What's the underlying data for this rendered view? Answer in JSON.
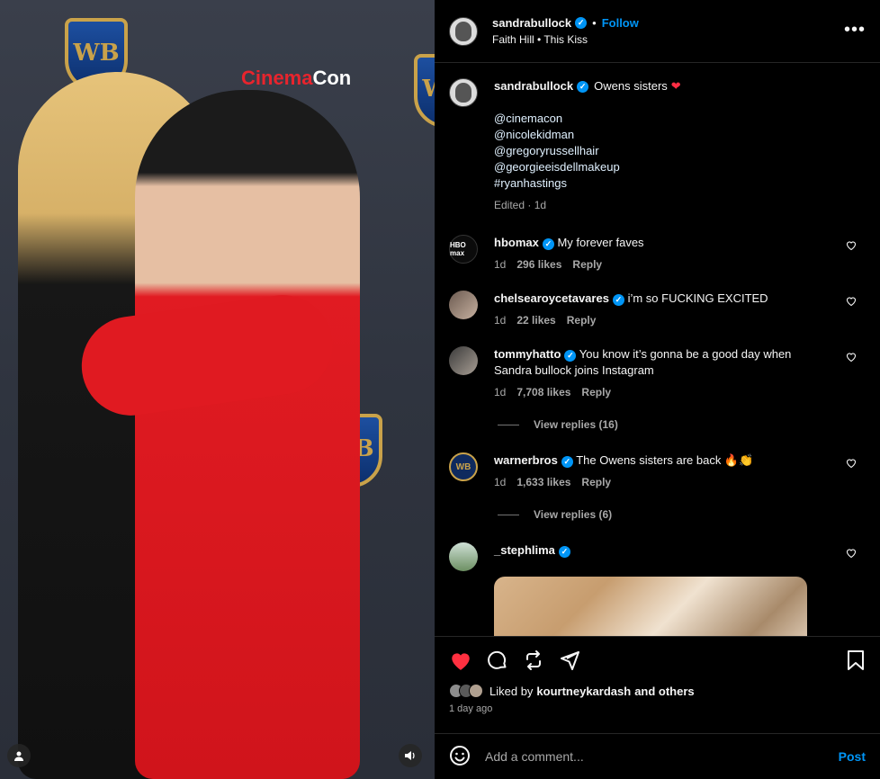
{
  "header": {
    "username": "sandrabullock",
    "follow_label": "Follow",
    "song": "Faith Hill • This Kiss",
    "more_label": "•••",
    "dot": "•"
  },
  "caption": {
    "username": "sandrabullock",
    "text": "Owens sisters",
    "emoji": "❤",
    "mentions": [
      "@cinemacon",
      "@nicolekidman",
      "@gregoryrussellhair",
      "@georgieeisdellmakeup",
      "#ryanhastings"
    ],
    "meta": "Edited · 1d"
  },
  "comments": [
    {
      "username": "hbomax",
      "text": "My forever faves",
      "time": "1d",
      "likes": "296 likes",
      "reply": "Reply",
      "avatar_label": "HBO max"
    },
    {
      "username": "chelsearoycetavares",
      "text": "i’m so FUCKING EXCITED",
      "time": "1d",
      "likes": "22 likes",
      "reply": "Reply"
    },
    {
      "username": "tommyhatto",
      "text": "You know it’s gonna be a good day when Sandra bullock joins Instagram",
      "time": "1d",
      "likes": "7,708 likes",
      "reply": "Reply",
      "view_replies": "View replies (16)"
    },
    {
      "username": "warnerbros",
      "text": "The Owens sisters are back 🔥👏",
      "time": "1d",
      "likes": "1,633 likes",
      "reply": "Reply",
      "view_replies": "View replies (6)",
      "avatar_label": "WB"
    },
    {
      "username": "_stephlima",
      "text": ""
    }
  ],
  "liked_by": {
    "prefix": "Liked by",
    "user": "kourtneykardash",
    "suffix": "and others"
  },
  "time_ago": "1 day ago",
  "add_comment": {
    "placeholder": "Add a comment...",
    "post_label": "Post"
  },
  "backdrop": {
    "logo_text": "WB",
    "cinemacon_a": "Cinema",
    "cinemacon_b": "Con"
  },
  "colors": {
    "accent": "#0095f6",
    "like_red": "#ff3040",
    "background": "#000000"
  },
  "icons": [
    "heart-icon",
    "comment-icon",
    "repost-icon",
    "share-icon",
    "bookmark-icon",
    "emoji-icon",
    "user-tag-icon",
    "sound-icon"
  ]
}
